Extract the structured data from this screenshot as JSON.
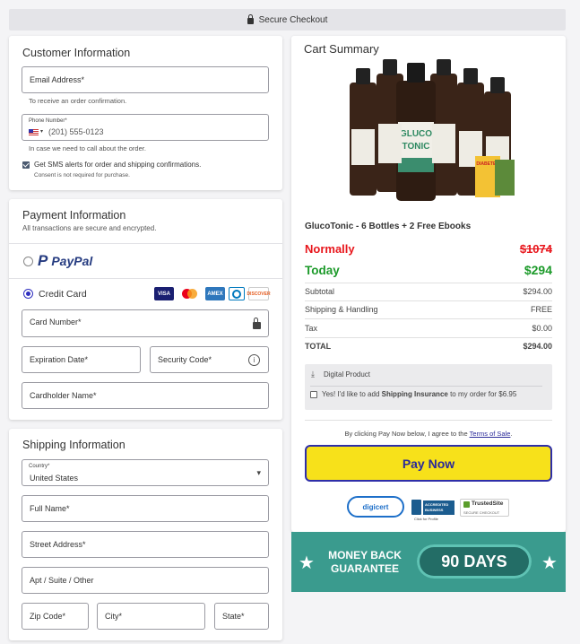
{
  "topbar": {
    "label": "Secure Checkout"
  },
  "customer": {
    "title": "Customer Information",
    "email_label": "Email Address*",
    "email_help": "To receive an order confirmation.",
    "phone_label": "Phone Number*",
    "phone_placeholder": "(201) 555-0123",
    "phone_help": "In case we need to call about the order.",
    "sms_label": "Get SMS alerts for order and shipping confirmations.",
    "sms_note": "Consent is not required for purchase."
  },
  "payment": {
    "title": "Payment Information",
    "subtitle": "All transactions are secure and encrypted.",
    "paypal_text": "PayPal",
    "credit_card_label": "Credit Card",
    "card_logos": [
      "VISA",
      "MC",
      "AMEX",
      "DC",
      "DISCOVER"
    ],
    "card_number": "Card Number*",
    "expiration": "Expiration Date*",
    "security_code": "Security Code*",
    "cardholder": "Cardholder Name*"
  },
  "shipping": {
    "title": "Shipping Information",
    "country_label": "Country*",
    "country_value": "United States",
    "full_name": "Full Name*",
    "street": "Street Address*",
    "apt": "Apt / Suite / Other",
    "zip": "Zip Code*",
    "city": "City*",
    "state": "State*"
  },
  "cart": {
    "title": "Cart Summary",
    "product_name": "GlucoTonic - 6 Bottles + 2 Free Ebooks",
    "bottle_text_1": "GLUCO",
    "bottle_text_2": "TONIC",
    "ebook_badge": "DIABETES",
    "normally_label": "Normally",
    "normally_price": "$1074",
    "today_label": "Today",
    "today_price": "$294",
    "subtotal_label": "Subtotal",
    "subtotal_value": "$294.00",
    "shipping_label": "Shipping & Handling",
    "shipping_value": "FREE",
    "tax_label": "Tax",
    "tax_value": "$0.00",
    "total_label": "TOTAL",
    "total_value": "$294.00",
    "digital_label": "Digital Product",
    "insurance_pre": "Yes! I'd like to add ",
    "insurance_bold": "Shipping Insurance",
    "insurance_post": " to my order for $6.95",
    "terms_pre": "By clicking Pay Now below, I agree to the ",
    "terms_link": "Terms of Sale",
    "terms_post": ".",
    "pay_button": "Pay Now",
    "badges": {
      "digicert": "digicert",
      "bbb_1": "ACCREDITED",
      "bbb_2": "BUSINESS",
      "bbb_3": "Click for Profile",
      "trusted_1": "TrustedSite",
      "trusted_2": "SECURE CHECKOUT"
    },
    "guarantee_line1": "MONEY BACK",
    "guarantee_line2": "GUARANTEE",
    "guarantee_days": "90 DAYS"
  },
  "colors": {
    "red": "#e8161c",
    "green": "#1c9a2a",
    "accent": "#2f2fbf",
    "pay_yellow": "#f7e11a",
    "teal": "#3a9b8e"
  }
}
